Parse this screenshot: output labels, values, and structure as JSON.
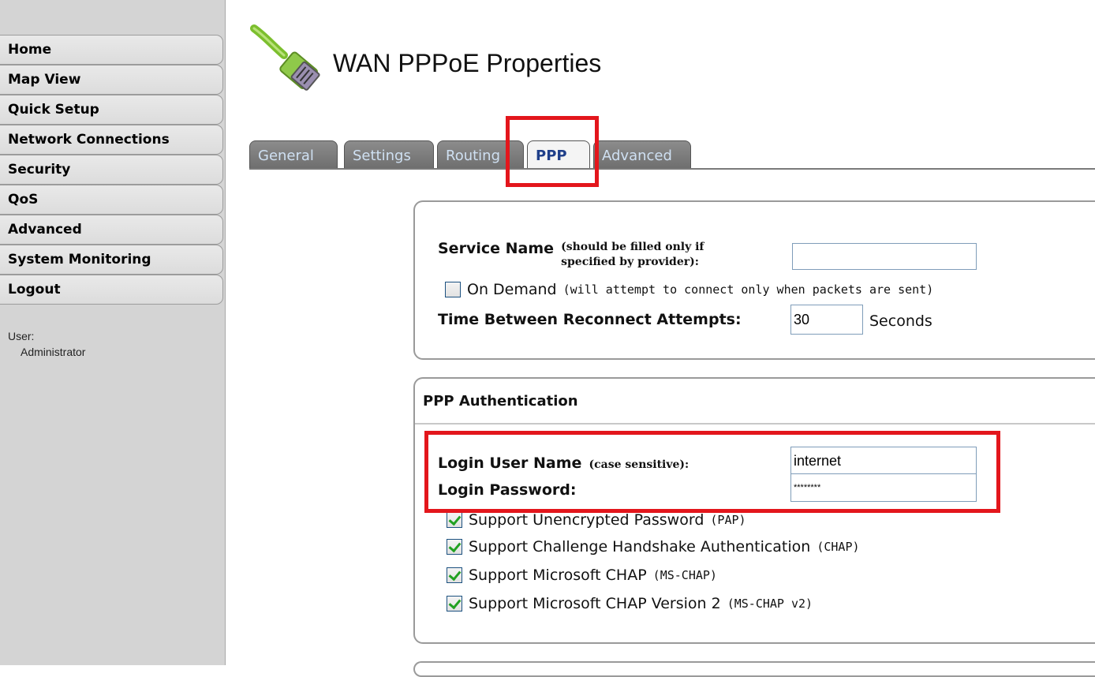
{
  "sidebar": {
    "items": [
      {
        "label": "Home"
      },
      {
        "label": "Map View"
      },
      {
        "label": "Quick Setup"
      },
      {
        "label": "Network Connections"
      },
      {
        "label": "Security"
      },
      {
        "label": "QoS"
      },
      {
        "label": "Advanced"
      },
      {
        "label": "System Monitoring"
      },
      {
        "label": "Logout"
      }
    ],
    "user_label": "User:",
    "user_name": "Administrator"
  },
  "header": {
    "title": "WAN PPPoE Properties",
    "icon": "network-cable-icon"
  },
  "tabs": [
    {
      "label": "General",
      "active": false
    },
    {
      "label": "Settings",
      "active": false
    },
    {
      "label": "Routing",
      "active": false
    },
    {
      "label": "PPP",
      "active": true
    },
    {
      "label": "Advanced",
      "active": false
    }
  ],
  "service_panel": {
    "service_name_label": "Service Name",
    "service_name_note": "(should be filled only if specified by provider):",
    "service_name_value": "",
    "on_demand_label": "On Demand",
    "on_demand_note": "(will attempt to connect only when packets are sent)",
    "on_demand_checked": false,
    "reconnect_label": "Time Between Reconnect Attempts:",
    "reconnect_value": "30",
    "reconnect_unit": "Seconds"
  },
  "auth_panel": {
    "title": "PPP Authentication",
    "login_user_label": "Login User Name",
    "login_user_note": "(case sensitive):",
    "login_user_value": "internet",
    "login_password_label": "Login Password:",
    "login_password_value": "********",
    "options": [
      {
        "label": "Support Unencrypted Password",
        "note": "(PAP)",
        "checked": true
      },
      {
        "label": "Support Challenge Handshake Authentication",
        "note": "(CHAP)",
        "checked": true
      },
      {
        "label": "Support Microsoft CHAP",
        "note": "(MS-CHAP)",
        "checked": true
      },
      {
        "label": "Support Microsoft CHAP Version 2",
        "note": "(MS-CHAP v2)",
        "checked": true
      }
    ]
  },
  "colors": {
    "highlight": "#e3161c",
    "tab_active_text": "#1f3f8a",
    "check_mark": "#21a121"
  }
}
